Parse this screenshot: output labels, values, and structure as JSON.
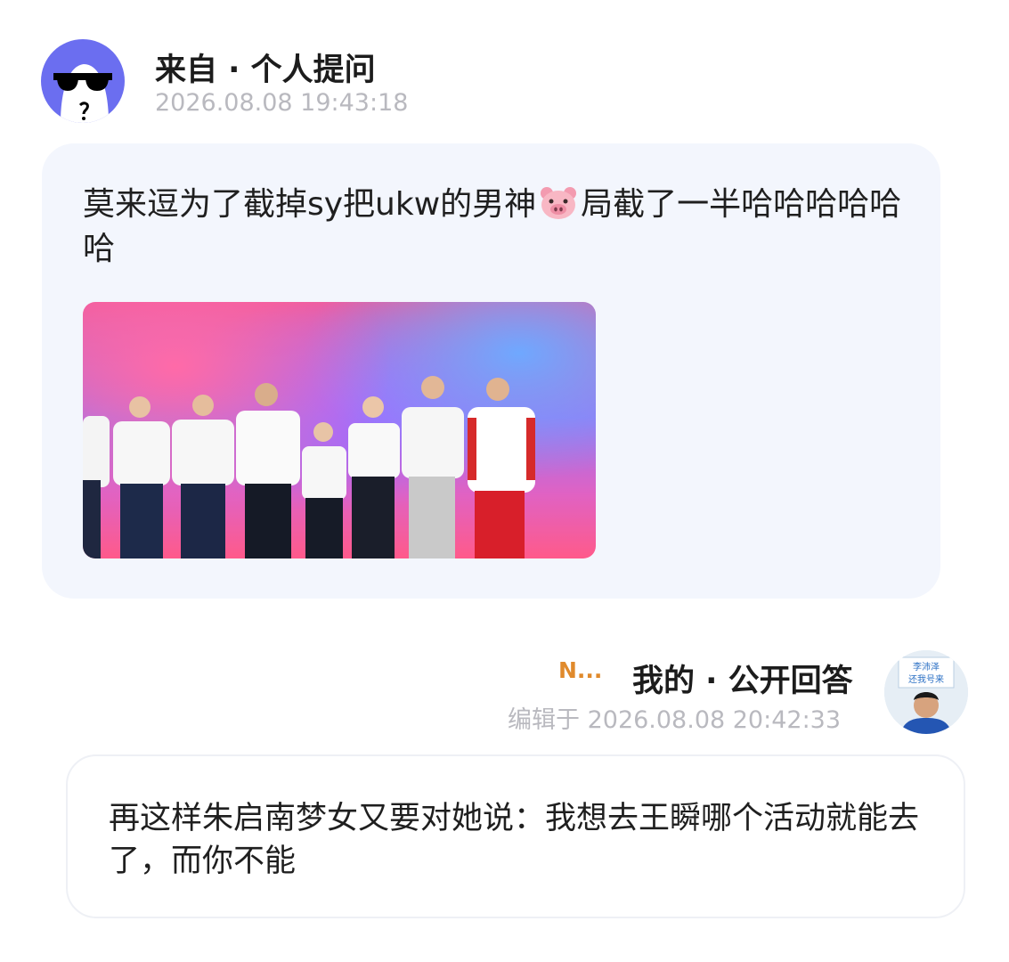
{
  "question": {
    "title": "来自 · 个人提问",
    "time": "2026.08.08 19:43:18",
    "text_part1": "莫来逗为了截掉sy把ukw的男神",
    "emoji": "pig-face-icon",
    "text_part2": "局截了一半哈哈哈哈哈哈"
  },
  "answer": {
    "name": "N...",
    "title": "我的 · 公开回答",
    "time": "编辑于 2026.08.08 20:42:33",
    "avatar_sign": [
      "李沛泽",
      "还我号来"
    ],
    "text": "再这样朱启南梦女又要对她说：我想去王瞬哪个活动就能去了，而你不能"
  },
  "colors": {
    "question_bubble": "#f3f6fd",
    "avatar_bg": "#6b6ef0",
    "name_accent": "#e08a2c",
    "muted_text": "#b9b9bf"
  }
}
